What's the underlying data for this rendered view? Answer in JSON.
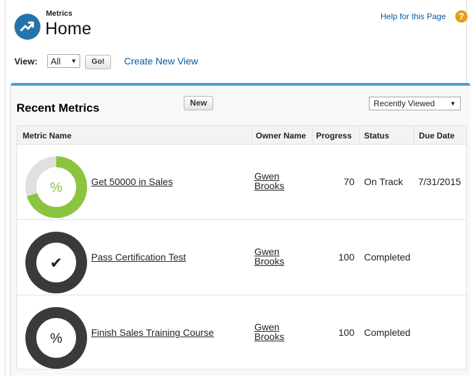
{
  "header": {
    "kicker": "Metrics",
    "title": "Home",
    "help_link": "Help for this Page",
    "help_icon": "?"
  },
  "view": {
    "label": "View:",
    "selected": "All",
    "go_button": "Go!",
    "create_link": "Create New View"
  },
  "panel": {
    "title": "Recent Metrics",
    "new_button": "New",
    "filter_selected": "Recently Viewed"
  },
  "table": {
    "columns": [
      "Metric Name",
      "Owner Name",
      "Progress",
      "Status",
      "Due Date"
    ],
    "rows": [
      {
        "icon": "%",
        "name": "Get 50000 in Sales",
        "owner_first": "Gwen",
        "owner_last": "Brooks",
        "progress": "70",
        "status": "On Track",
        "due": "7/31/2015",
        "ring_fill": 0.7,
        "ring_color": "#8bc53f",
        "icon_color": "#8bc53f"
      },
      {
        "icon": "✔",
        "name": "Pass Certification Test",
        "owner_first": "Gwen",
        "owner_last": "Brooks",
        "progress": "100",
        "status": "Completed",
        "due": "",
        "ring_fill": 1.0,
        "ring_color": "#3a3a3a",
        "icon_color": "#222222"
      },
      {
        "icon": "%",
        "name": "Finish Sales Training Course",
        "owner_first": "Gwen",
        "owner_last": "Brooks",
        "progress": "100",
        "status": "Completed",
        "due": "",
        "ring_fill": 1.0,
        "ring_color": "#3a3a3a",
        "icon_color": "#222222"
      }
    ]
  },
  "colors": {
    "accent_blue": "#4a9cd8",
    "link_blue": "#015ba7",
    "help_orange": "#e79d19",
    "ring_track": "#e0e0e0"
  }
}
